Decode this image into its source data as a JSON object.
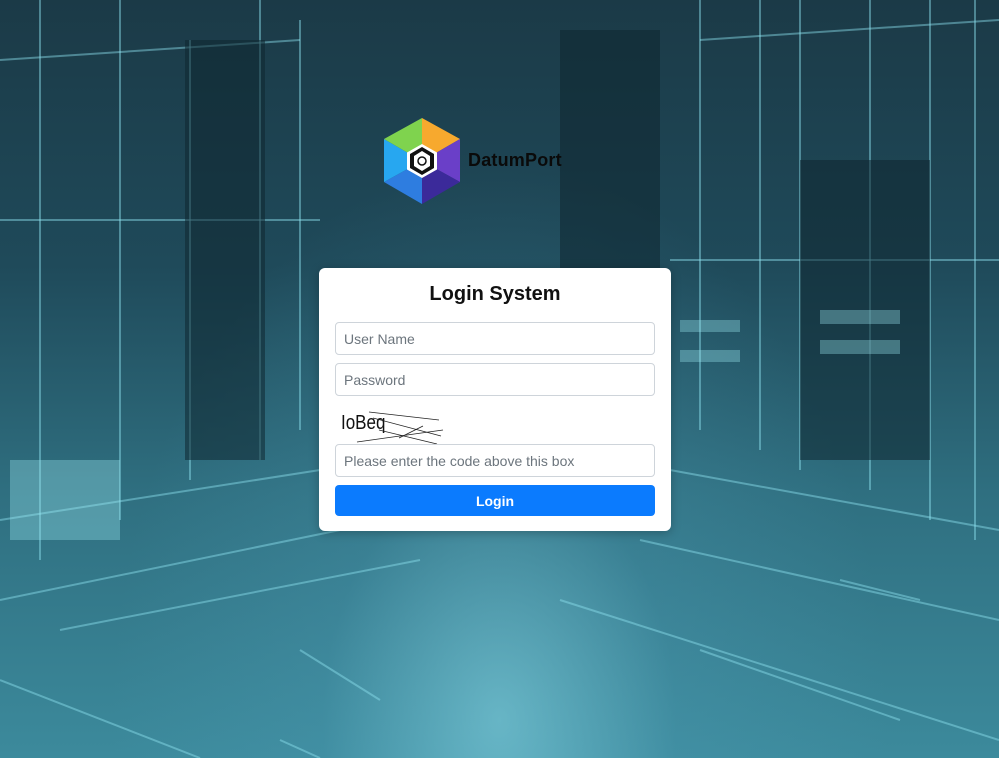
{
  "brand": {
    "name": "DatumPort",
    "logo_icon": "hexagon-logo-icon"
  },
  "login": {
    "title": "Login System",
    "username_placeholder": "User Name",
    "password_placeholder": "Password",
    "captcha_text": "IoBeq",
    "code_placeholder": "Please enter the code above this box",
    "submit_label": "Login"
  },
  "colors": {
    "primary": "#0b7bfe",
    "card_bg": "#ffffff",
    "background_teal": "#2f6f80"
  }
}
